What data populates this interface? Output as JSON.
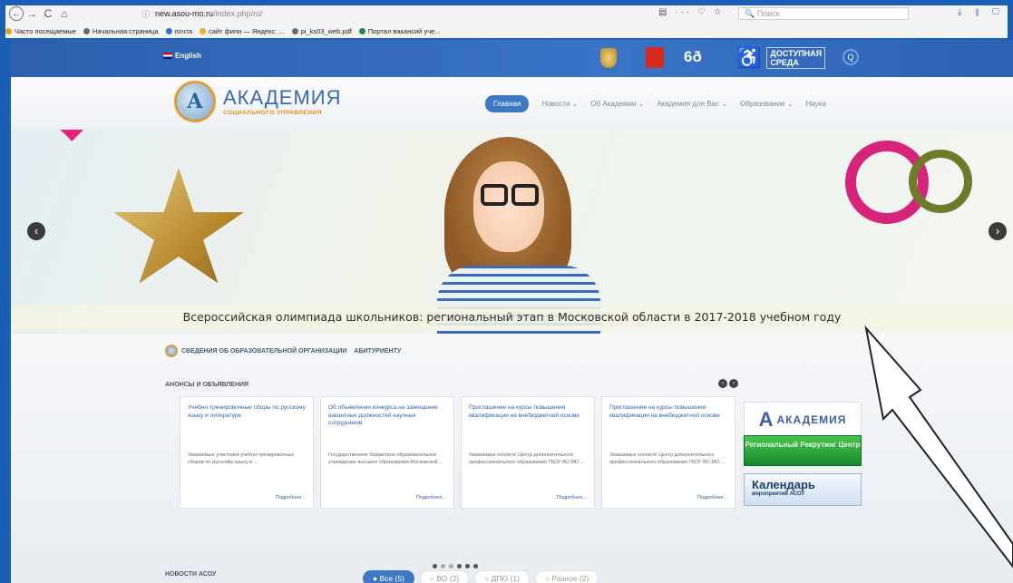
{
  "browser": {
    "nav": {
      "back_icon": "←",
      "forward_icon": "→",
      "reload_icon": "C",
      "home_icon": "⌂"
    },
    "url_prefix": "ⓘ",
    "url_host": "new.asou-mo.ru",
    "url_path": "/index.php/ru/",
    "url_actions": "▤ ··· ♡ ☆",
    "search_placeholder": "🔍 Поиск",
    "right_icons": "⤓ ⫴ ▢",
    "bookmarks": [
      {
        "label": "Часто посещаемые",
        "color": "#e0a020"
      },
      {
        "label": "Начальная страница",
        "color": "#6b6b6b"
      },
      {
        "label": "почта",
        "color": "#2f6fd1"
      },
      {
        "label": "сайт фипи — Яндекс: ...",
        "color": "#e8b323"
      },
      {
        "label": "pi_ks03_web.pdf",
        "color": "#6b6b6b"
      },
      {
        "label": "Портал вакансий уче...",
        "color": "#1d8a4a"
      }
    ]
  },
  "topbar": {
    "english": "English",
    "glasses": "6ð",
    "accessible_line1": "ДОСТУПНАЯ",
    "accessible_line2": "СРЕДА",
    "search_icon": "Q"
  },
  "header": {
    "logo_letter": "А",
    "brand_name": "АКАДЕМИЯ",
    "brand_sub": "СОЦИАЛЬНОГО УПРАВЛЕНИЯ",
    "nav": [
      {
        "label": "Главная",
        "active": true
      },
      {
        "label": "Новости ⌄"
      },
      {
        "label": "Об Академии ⌄"
      },
      {
        "label": "Академия для Вас ⌄"
      },
      {
        "label": "Образование ⌄"
      },
      {
        "label": "Наука"
      }
    ]
  },
  "slider": {
    "prev": "‹",
    "next": "›",
    "caption": "Всероссийская олимпиада школьников: региональный этап в Московской области в 2017-2018 учебном году"
  },
  "content": {
    "link_org": "СВЕДЕНИЯ ОБ ОБРАЗОВАТЕЛЬНОЙ ОРГАНИЗАЦИИ",
    "link_applicant": "АБИТУРИЕНТУ",
    "announce_title": "АНОНСЫ И ОБЪЯВЛЕНИЯ",
    "cards": [
      {
        "title": "Учебно-тренировочные сборы по русскому языку и литературе",
        "body": "Уважаемые участники учебно-тренировочных сборов по русскому языку и ...",
        "more": "Подробнее..."
      },
      {
        "title": "Об объявлении конкурса на замещение вакантных должностей научных сотрудников",
        "body": "Государственное бюджетное образовательное учреждение высшего образования Московской ...",
        "more": "Подробнее..."
      },
      {
        "title": "Приглашение на курсы повышения квалификации на внебюджетной основе",
        "body": "Уважаемые коллеги! Центр дополнительного профессионального образования ГБОУ ВО МО ...",
        "more": "Подробнее..."
      },
      {
        "title": "Приглашение на курсы повышения квалификации на внебюджетной основе",
        "body": "Уважаемые коллеги! Центр дополнительного профессионального образования ГБОУ ВО МО ...",
        "more": "Подробнее..."
      }
    ],
    "banner_academy": "АКАДЕМИЯ",
    "banner_recruit": "Региональный Рекрутинг Центр",
    "banner_calendar_title": "Календарь",
    "banner_calendar_sub": "мероприятий АСОУ",
    "news_title": "НОВОСТИ АСОУ",
    "filters": [
      {
        "label": "● Все (5)",
        "active": true
      },
      {
        "label": "○ ВО (2)"
      },
      {
        "label": "○ ДПО (1)"
      },
      {
        "label": "○ Разное (2)"
      }
    ]
  },
  "colors": {
    "accent_blue": "#3f78c2",
    "ring_pink": "#d6247a",
    "ring_olive": "#6f7a2a"
  }
}
